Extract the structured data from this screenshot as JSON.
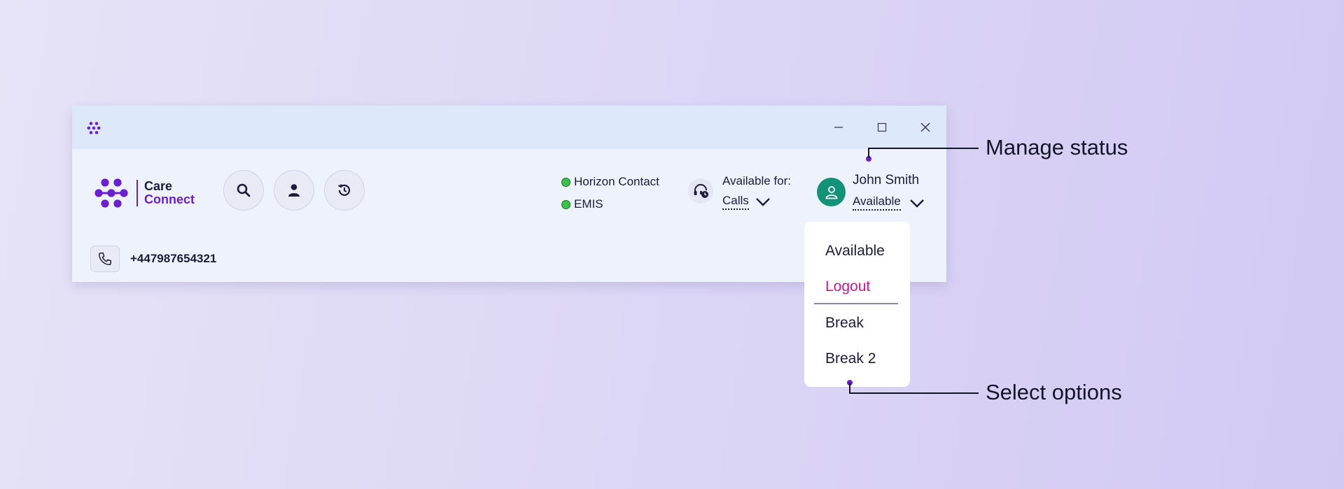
{
  "colors": {
    "brand_purple": "#6a1fd0",
    "status_green": "#3cc24a",
    "avatar_teal": "#13927a",
    "logout_pink": "#d4148a"
  },
  "titlebar": {
    "icons": [
      "app-logo-icon",
      "minimize-icon",
      "maximize-icon",
      "close-icon"
    ]
  },
  "brand": {
    "line1": "Care",
    "line2": "Connect"
  },
  "toolbar": {
    "icons": [
      "search-icon",
      "contact-icon",
      "history-icon"
    ]
  },
  "systems": [
    {
      "label": "Horizon Contact",
      "status": "connected"
    },
    {
      "label": "EMIS",
      "status": "connected"
    }
  ],
  "availability": {
    "label": "Available for:",
    "value": "Calls"
  },
  "user": {
    "name": "John Smith",
    "status": "Available"
  },
  "phone": {
    "number": "+447987654321"
  },
  "status_menu": {
    "items": [
      {
        "label": "Available"
      },
      {
        "label": "Logout"
      },
      {
        "label": "Break"
      },
      {
        "label": "Break 2"
      }
    ]
  },
  "callouts": {
    "top": "Manage status",
    "bottom": "Select options"
  }
}
